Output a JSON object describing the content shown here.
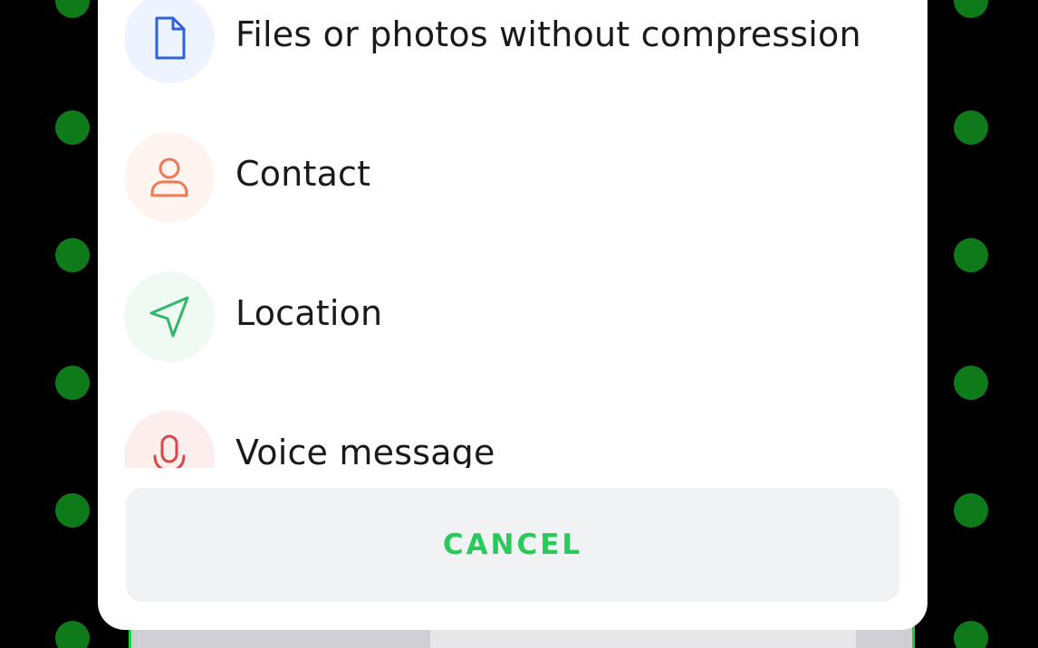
{
  "colors": {
    "accent": "#2bc95b",
    "file_icon": "#2f62d8",
    "file_bg": "#eef4ff",
    "contact_icon": "#ee7a55",
    "contact_bg": "#fff4ef",
    "location_icon": "#32b76a",
    "location_bg": "#effaf3",
    "voice_icon": "#d84848",
    "voice_bg": "#fdeeee"
  },
  "attach_menu": {
    "items": [
      {
        "label": "Files or photos without compression",
        "icon": "file-icon"
      },
      {
        "label": "Contact",
        "icon": "contact-icon"
      },
      {
        "label": "Location",
        "icon": "location-icon"
      },
      {
        "label": "Voice message",
        "icon": "microphone-icon"
      }
    ],
    "cancel_label": "CANCEL"
  }
}
